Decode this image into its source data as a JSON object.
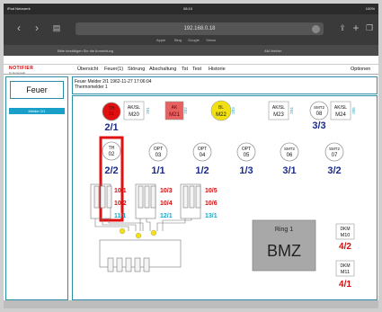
{
  "statusbar": {
    "left": "iPad Netzwerk",
    "center": "08:10",
    "right": "100%"
  },
  "browser": {
    "url": "192.168.0.18",
    "favorites": [
      "Apple",
      "Bing",
      "Google",
      "Yahoo"
    ],
    "tab_left": "Bitte bestätigen Sie die Anmeldung",
    "tab_right": "AM Melder"
  },
  "app": {
    "logo_brand": "NOTIFIER",
    "logo_sub": "by Honeywell",
    "menu": [
      "Übersicht",
      "Feuer(1)",
      "Störung",
      "Abschaltung",
      "Tst",
      "Test",
      "Historie"
    ],
    "options": "Optionen",
    "feuer_button": "Feuer",
    "melder_tab": "Melder 2/1",
    "info_line1": "Feuer Melder 2/1 1962-11-27 17:06:04",
    "info_line2": "Thermomelder 1"
  },
  "plan": {
    "detectors": [
      {
        "label": "TH",
        "num": "01",
        "addr": "2/1",
        "style": "alarm"
      },
      {
        "label": "TH",
        "num": "02",
        "addr": "2/2",
        "style": "normal"
      },
      {
        "label": "OPT",
        "num": "03",
        "addr": "1/1",
        "style": "normal"
      },
      {
        "label": "OPT",
        "num": "04",
        "addr": "1/2",
        "style": "normal"
      },
      {
        "label": "OPT",
        "num": "05",
        "addr": "1/3",
        "style": "normal"
      },
      {
        "label": "SMT2",
        "num": "06",
        "addr": "3/1",
        "style": "normal"
      },
      {
        "label": "SMT2",
        "num": "07",
        "addr": "3/2",
        "style": "normal"
      }
    ],
    "modules": [
      {
        "label": "AK/SL",
        "num": "M20",
        "side": "201",
        "style": "plain"
      },
      {
        "label": "AK",
        "num": "M21",
        "side": "202",
        "style": "red"
      },
      {
        "label": "BL",
        "num": "M22",
        "side": "203",
        "style": "yellow"
      },
      {
        "label": "AK/SL",
        "num": "M23",
        "side": "204",
        "style": "plain"
      },
      {
        "label": "SMT2",
        "num": "08",
        "side": "",
        "style": "plain"
      },
      {
        "label": "AK/SL",
        "num": "M24",
        "side": "205",
        "style": "plain"
      }
    ],
    "addr_3_3": "3/3",
    "zone_col1": [
      "10/1",
      "10/2",
      "11/1"
    ],
    "zone_col2": [
      "10/3",
      "10/4",
      "12/1"
    ],
    "zone_col3": [
      "10/5",
      "10/6",
      "13/1"
    ],
    "ring_label": "Ring 1",
    "bmz_label": "BMZ",
    "dkm": [
      {
        "label": "DKM",
        "num": "M10",
        "addr": "4/2"
      },
      {
        "label": "DKM",
        "num": "M11",
        "addr": "4/1"
      }
    ]
  },
  "colors": {
    "accent": "#2a8fa5",
    "alarm_red": "#e01010",
    "addr_blue": "#1a2a8a",
    "zone_red": "#d01010",
    "zone_cyan": "#18a8c8",
    "yellow": "#f2e010"
  }
}
